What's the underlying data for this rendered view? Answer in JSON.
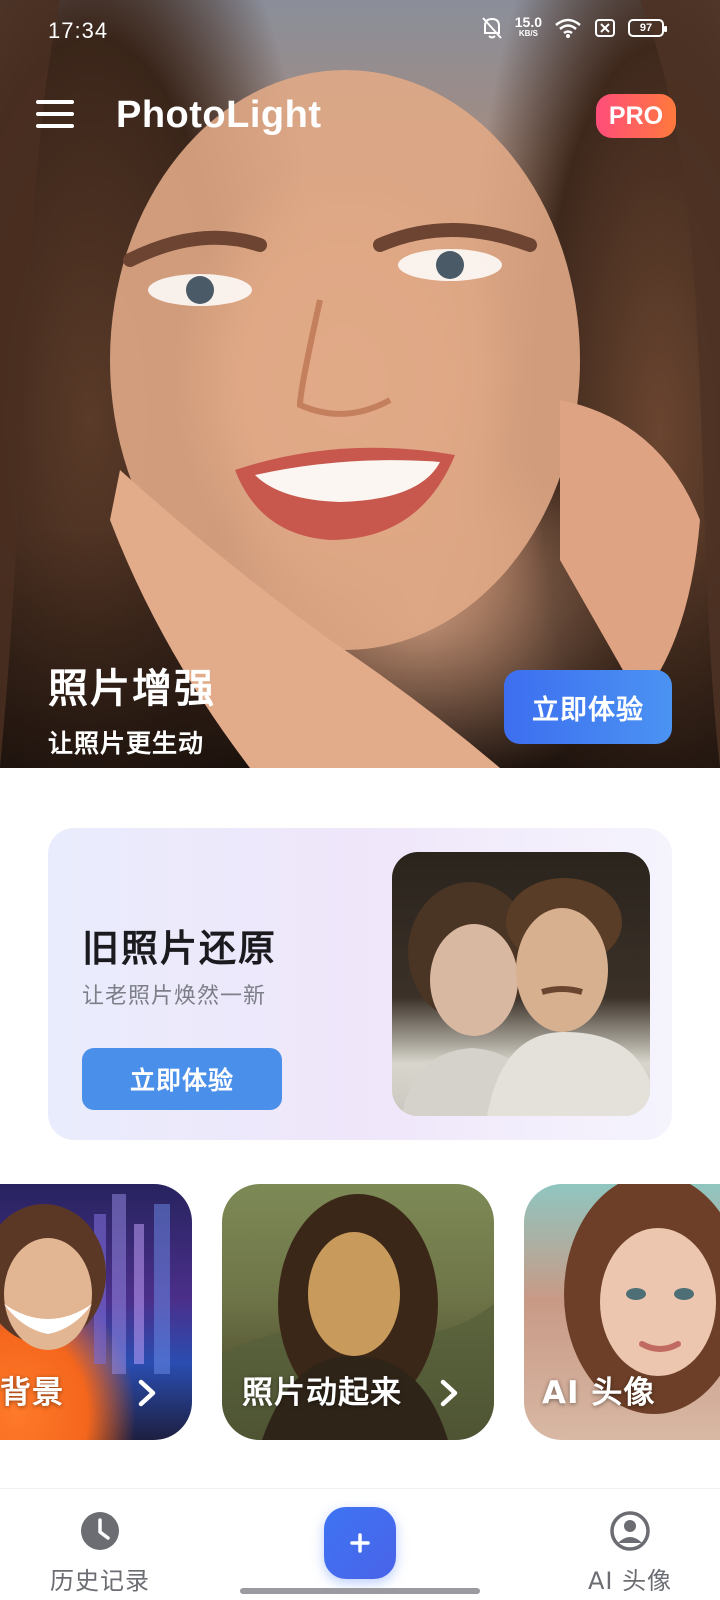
{
  "status_bar": {
    "time": "17:34",
    "net_speed_value": "15.0",
    "net_speed_unit": "KB/S",
    "battery": "97"
  },
  "app_bar": {
    "title": "PhotoLight",
    "pro_badge": "PRO"
  },
  "hero": {
    "title": "照片增强",
    "subtitle": "让照片更生动",
    "cta": "立即体验"
  },
  "restore_card": {
    "title": "旧照片还原",
    "subtitle": "让老照片焕然一新",
    "cta": "立即体验"
  },
  "features": [
    {
      "label": "背景"
    },
    {
      "label": "照片动起来"
    },
    {
      "label": "AI 头像"
    }
  ],
  "bottom_nav": {
    "history_label": "历史记录",
    "ai_avatar_label": "AI 头像"
  },
  "colors": {
    "accent_blue": "#4a8fe9",
    "pro_gradient_start": "#ff4d7a",
    "pro_gradient_end": "#ff7a3c",
    "fab_blue": "#3d74f3"
  }
}
